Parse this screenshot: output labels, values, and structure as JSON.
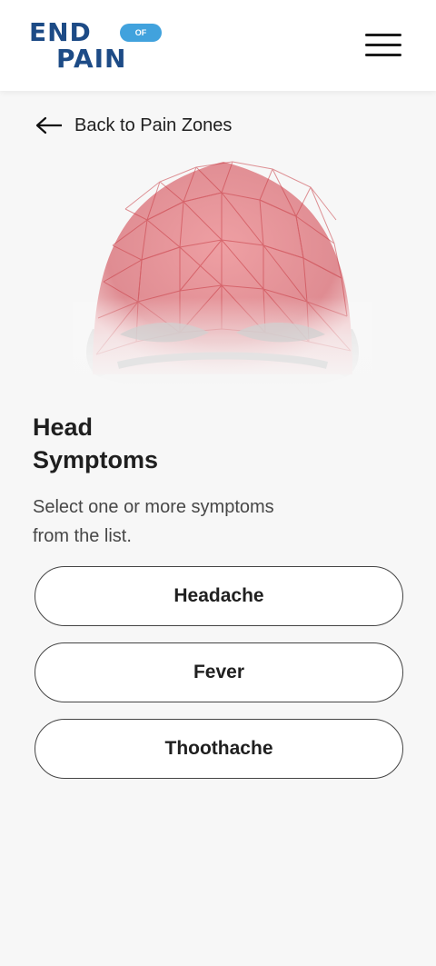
{
  "header": {
    "logo_top": "END",
    "logo_of": "OF",
    "logo_bottom": "PAIN",
    "menu_icon": "hamburger-menu-icon",
    "brand_color": "#1d4b86",
    "accent_color": "#41a2dd"
  },
  "back": {
    "icon": "arrow-left-icon",
    "label": "Back to Pain Zones"
  },
  "illustration": {
    "icon": "head-mesh-illustration",
    "highlight_color": "#e08d93"
  },
  "content": {
    "title_line1": "Head",
    "title_line2": "Symptoms",
    "instructions_line1": "Select one or more symptoms",
    "instructions_line2": "from the list."
  },
  "symptoms": [
    {
      "label": "Headache"
    },
    {
      "label": "Fever"
    },
    {
      "label": "Thoothache"
    }
  ]
}
